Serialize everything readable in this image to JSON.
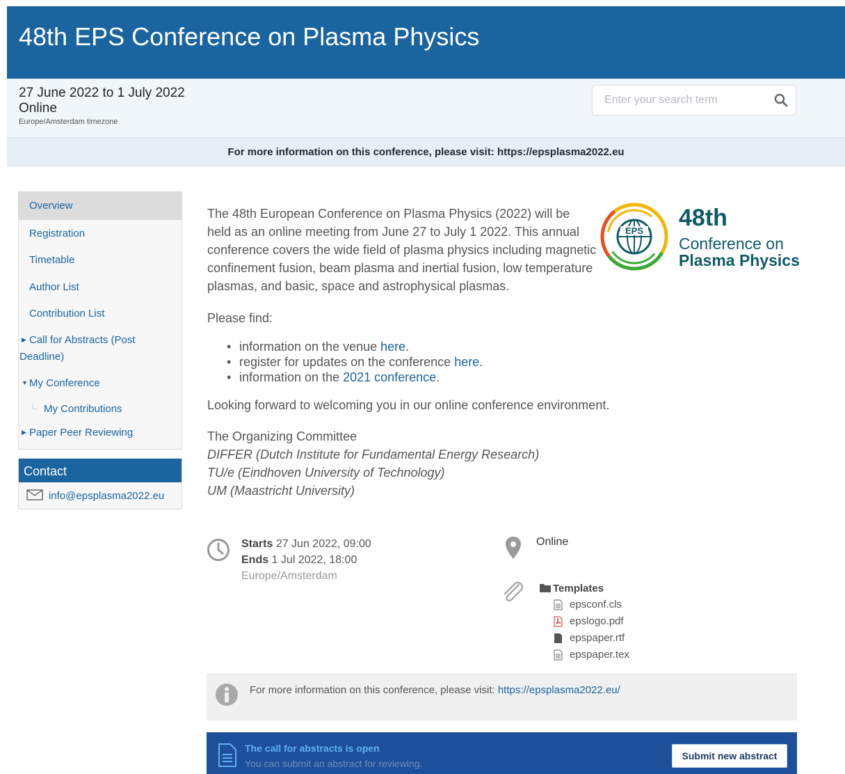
{
  "header": {
    "title": "48th EPS Conference on Plasma Physics",
    "dates": "27 June 2022 to 1 July 2022",
    "location": "Online",
    "timezone": "Europe/Amsterdam timezone",
    "search_placeholder": "Enter your search term"
  },
  "announcement": "For more information on this conference, please visit: https://epsplasma2022.eu",
  "menu": {
    "items": [
      {
        "label": "Overview"
      },
      {
        "label": "Registration"
      },
      {
        "label": "Timetable"
      },
      {
        "label": "Author List"
      },
      {
        "label": "Contribution List"
      },
      {
        "label": "Call for Abstracts (Post",
        "label2": "Deadline)"
      },
      {
        "label": "My Conference"
      },
      {
        "label": "My Contributions"
      },
      {
        "label": "Paper Peer Reviewing"
      }
    ]
  },
  "contact": {
    "title": "Contact",
    "email": "info@epsplasma2022.eu"
  },
  "content": {
    "intro": "The 48th European Conference on Plasma Physics (2022) will be held as an online meeting from June 27 to July 1 2022. This annual conference covers the wide field of plasma physics including magnetic confinement fusion, beam plasma and inertial fusion, low temperature plasmas, and basic, space and astrophysical plasmas.",
    "please_find": "Please find:",
    "bullets": [
      {
        "text": "information on the venue ",
        "link": "here",
        "after": "."
      },
      {
        "text": "register for updates on the conference ",
        "link": "here",
        "after": "."
      },
      {
        "text": "information on the ",
        "link": "2021 conference",
        "after": "."
      }
    ],
    "looking": "Looking forward to welcoming you in our online conference environment.",
    "committee_title": "The Organizing Committee",
    "committee": [
      "DIFFER (Dutch Institute for Fundamental Energy Research)",
      "TU/e (Eindhoven University of Technology)",
      "UM (Maastricht University)"
    ]
  },
  "logo": {
    "line1": "48th",
    "line2": "Conference on",
    "line3": "Plasma Physics",
    "badge": "EPS"
  },
  "details": {
    "starts_label": "Starts",
    "starts": "27 Jun 2022, 09:00",
    "ends_label": "Ends",
    "ends": "1 Jul 2022, 18:00",
    "tz": "Europe/Amsterdam",
    "venue": "Online"
  },
  "attachments": {
    "folder": "Templates",
    "files": [
      {
        "name": "epsconf.cls",
        "icon": "text-file-icon"
      },
      {
        "name": "epslogo.pdf",
        "icon": "pdf-file-icon"
      },
      {
        "name": "epspaper.rtf",
        "icon": "filled-file-icon"
      },
      {
        "name": "epspaper.tex",
        "icon": "text-file-icon"
      }
    ]
  },
  "info_box": {
    "text": "For more information on this conference, please visit: ",
    "link": "https://epsplasma2022.eu/"
  },
  "cfa": {
    "title": "The call for abstracts is open",
    "subtitle": "You can submit an abstract for reviewing.",
    "button": "Submit new abstract"
  },
  "colors": {
    "brand": "#1a64a0",
    "cfa_bg": "#1d4f9a",
    "logo_teal": "#0e5a66"
  }
}
